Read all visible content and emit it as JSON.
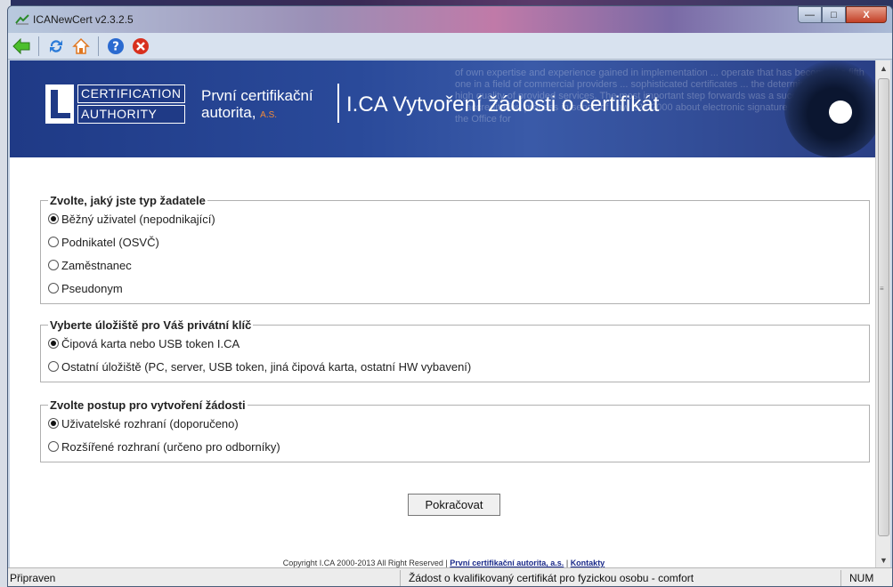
{
  "window": {
    "title": "ICANewCert v2.3.2.5",
    "minimize": "—",
    "maximize": "□",
    "close": "X"
  },
  "toolbar": {
    "icons": [
      "back-icon",
      "refresh-icon",
      "home-icon",
      "help-icon",
      "exit-icon"
    ]
  },
  "banner": {
    "logo_line1": "CERTIFICATION",
    "logo_line2": "AUTHORITY",
    "org_line1": "První certifikační",
    "org_line2": "autorita,",
    "org_as": "A.S.",
    "title": "I.CA Vytvoření žádosti o certifikát",
    "bg_text": "of own expertise and experience gained in implementation ... operate that has become the fifth one in a field of commercial providers ... sophisticated certificates ... the determining factors for high quality of provided services. The most important step forwards was a successful completion ... accreditation process in sense of Law 227/2000 about electronic signature and coherent ... the Office for"
  },
  "form": {
    "group1": {
      "legend": "Zvolte, jaký jste typ žadatele",
      "options": [
        {
          "label": "Běžný uživatel (nepodnikající)",
          "checked": true
        },
        {
          "label": "Podnikatel (OSVČ)",
          "checked": false
        },
        {
          "label": "Zaměstnanec",
          "checked": false
        },
        {
          "label": "Pseudonym",
          "checked": false
        }
      ]
    },
    "group2": {
      "legend": "Vyberte úložiště pro Váš privátní klíč",
      "options": [
        {
          "label": "Čipová karta nebo USB token I.CA",
          "checked": true
        },
        {
          "label": "Ostatní úložiště (PC, server, USB token, jiná čipová karta, ostatní HW vybavení)",
          "checked": false
        }
      ]
    },
    "group3": {
      "legend": "Zvolte postup pro vytvoření žádosti",
      "options": [
        {
          "label": "Uživatelské rozhraní (doporučeno)",
          "checked": true
        },
        {
          "label": "Rozšířené rozhraní (určeno pro odborníky)",
          "checked": false
        }
      ]
    },
    "continue_label": "Pokračovat"
  },
  "footer": {
    "copyright": "Copyright I.CA 2000-2013 All Right Reserved |",
    "link1": "První certifikační autorita, a.s.",
    "sep": "|",
    "link2": "Kontakty"
  },
  "status": {
    "left": "Připraven",
    "middle": "Žádost o kvalifikovaný certifikát pro fyzickou osobu - comfort",
    "right": "NUM"
  },
  "colors": {
    "banner": "#1f3a86",
    "accent_orange": "#f08a3a",
    "link": "#1a2a8a"
  }
}
